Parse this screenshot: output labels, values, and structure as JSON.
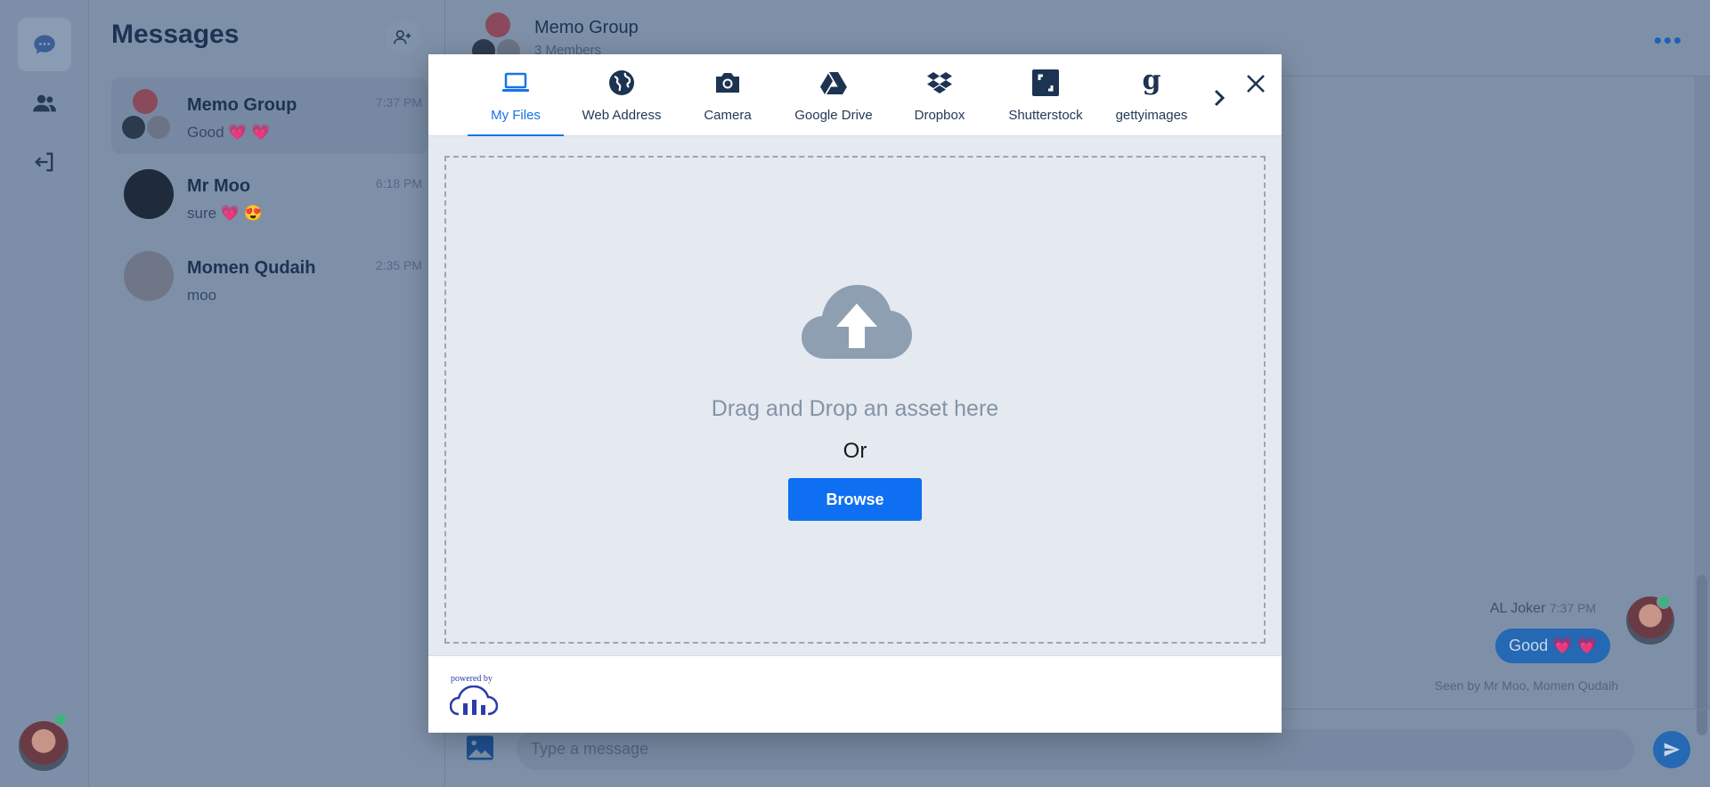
{
  "app": {
    "list_title": "Messages",
    "conversations": [
      {
        "name": "Memo Group",
        "time": "7:37 PM",
        "last": "Good 💗 💗"
      },
      {
        "name": "Mr Moo",
        "time": "6:18 PM",
        "last": "sure 💗 😍"
      },
      {
        "name": "Momen Qudaih",
        "time": "2:35 PM",
        "last": "moo"
      }
    ],
    "chat": {
      "title": "Memo Group",
      "subtitle": "3 Members",
      "message_sender": "AL Joker",
      "message_time": "7:37 PM",
      "message_text": "Good 💗 💗",
      "seen_by": "Seen by Mr Moo, Momen Qudaih",
      "composer_placeholder": "Type a message"
    }
  },
  "modal": {
    "tabs": [
      {
        "label": "My Files",
        "icon": "laptop-icon"
      },
      {
        "label": "Web Address",
        "icon": "globe-icon"
      },
      {
        "label": "Camera",
        "icon": "camera-icon"
      },
      {
        "label": "Google Drive",
        "icon": "google-drive-icon"
      },
      {
        "label": "Dropbox",
        "icon": "dropbox-icon"
      },
      {
        "label": "Shutterstock",
        "icon": "shutterstock-icon"
      },
      {
        "label": "gettyimages",
        "icon": "gettyimages-icon"
      }
    ],
    "drop_text": "Drag and Drop an asset here",
    "or_text": "Or",
    "browse_label": "Browse",
    "powered_by": "powered by"
  },
  "colors": {
    "accent": "#1a73e8",
    "browse_button": "#0f6ff2",
    "dim_overlay": "#7e90a8"
  }
}
